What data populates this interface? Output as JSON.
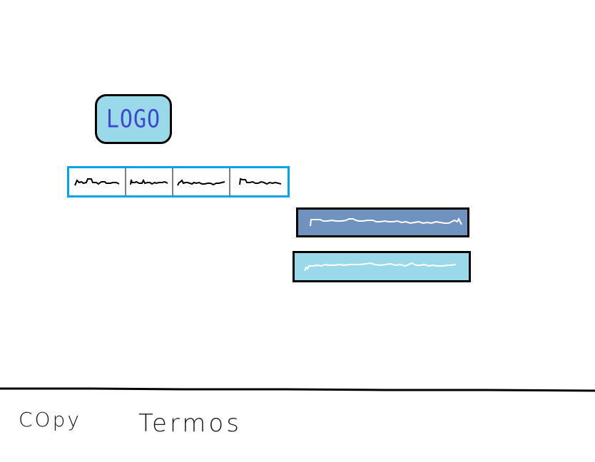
{
  "logo": {
    "text": "LOGO"
  },
  "nav": {
    "items": [
      {
        "name": "nav-item-1"
      },
      {
        "name": "nav-item-2"
      },
      {
        "name": "nav-item-3"
      },
      {
        "name": "nav-item-4"
      }
    ]
  },
  "buttons": {
    "primary_color": "#7092be",
    "secondary_color": "#99d9ea"
  },
  "footer": {
    "copy_label": "COpy",
    "terms_label": "Termos"
  },
  "colors": {
    "logo_bg": "#99d9ea",
    "logo_text": "#3f48cc",
    "nav_border": "#00a2e8",
    "nav_divider": "#7f7f7f"
  }
}
